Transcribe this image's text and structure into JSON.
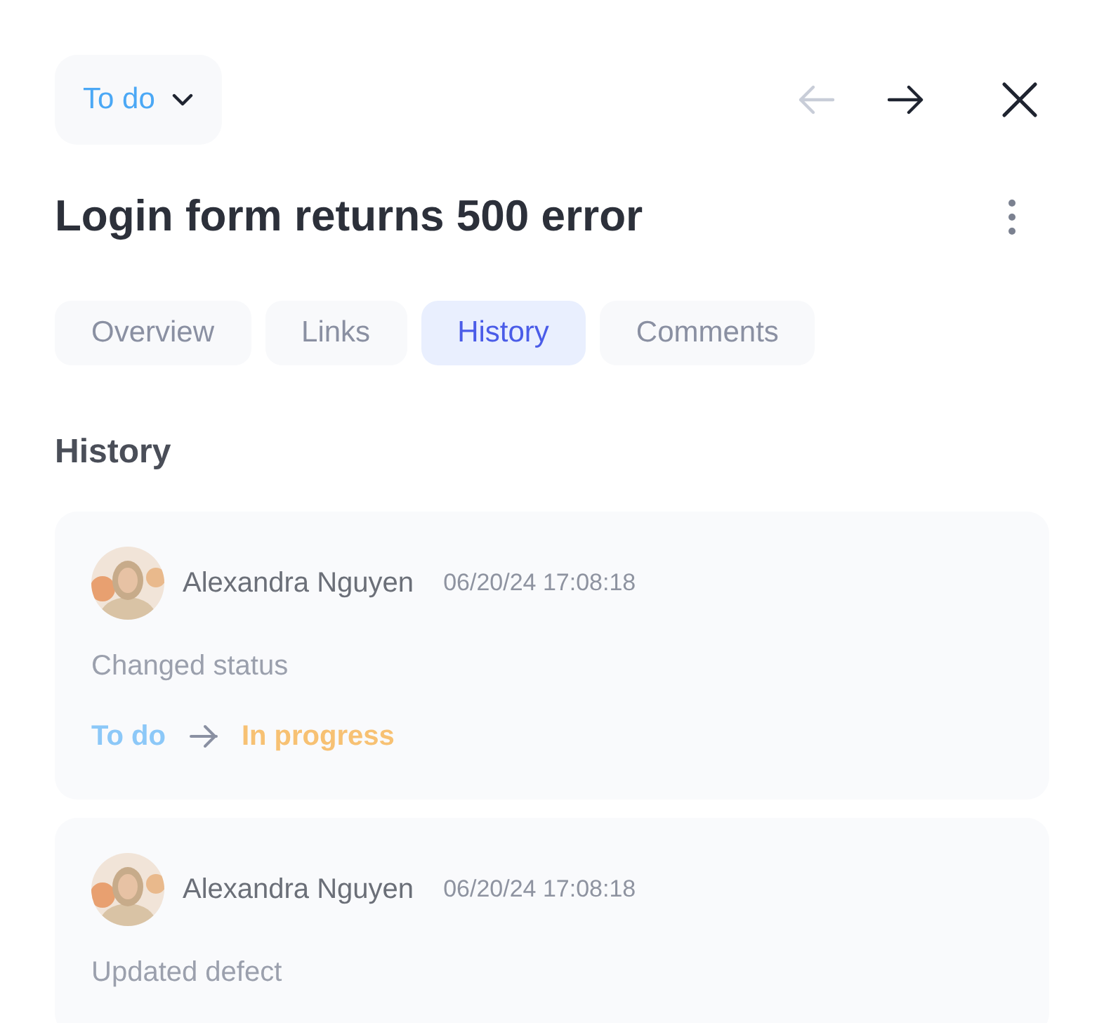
{
  "status_dropdown": {
    "label": "To do",
    "color": "#4ba8f5"
  },
  "navigation": {
    "previous_disabled": true,
    "next_disabled": false
  },
  "title": "Login form returns 500 error",
  "tabs": [
    {
      "label": "Overview",
      "selected": false
    },
    {
      "label": "Links",
      "selected": false
    },
    {
      "label": "History",
      "selected": true
    },
    {
      "label": "Comments",
      "selected": false
    }
  ],
  "section_title": "History",
  "history": [
    {
      "kind": "status_change",
      "author": "Alexandra Nguyen",
      "time": "06/20/24 17:08:18",
      "action": "Changed status",
      "from": {
        "label": "To do",
        "color": "#8cc8f8"
      },
      "to": {
        "label": "In progress",
        "color": "#f7c173"
      }
    },
    {
      "kind": "update",
      "author": "Alexandra Nguyen",
      "time": "06/20/24 17:08:18",
      "action": "Updated defect"
    }
  ]
}
